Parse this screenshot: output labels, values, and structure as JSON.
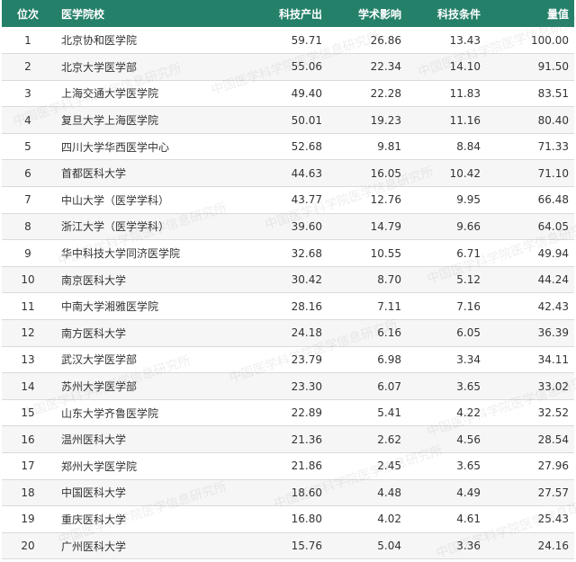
{
  "headers": {
    "rank": "位次",
    "school": "医学院校",
    "output": "科技产出",
    "influence": "学术影响",
    "conditions": "科技条件",
    "score": "量值"
  },
  "rows": [
    {
      "rank": "1",
      "school": "北京协和医学院",
      "output": "59.71",
      "influence": "26.86",
      "conditions": "13.43",
      "score": "100.00"
    },
    {
      "rank": "2",
      "school": "北京大学医学部",
      "output": "55.06",
      "influence": "22.34",
      "conditions": "14.10",
      "score": "91.50"
    },
    {
      "rank": "3",
      "school": "上海交通大学医学院",
      "output": "49.40",
      "influence": "22.28",
      "conditions": "11.83",
      "score": "83.51"
    },
    {
      "rank": "4",
      "school": "复旦大学上海医学院",
      "output": "50.01",
      "influence": "19.23",
      "conditions": "11.16",
      "score": "80.40"
    },
    {
      "rank": "5",
      "school": "四川大学华西医学中心",
      "output": "52.68",
      "influence": "9.81",
      "conditions": "8.84",
      "score": "71.33"
    },
    {
      "rank": "6",
      "school": "首都医科大学",
      "output": "44.63",
      "influence": "16.05",
      "conditions": "10.42",
      "score": "71.10"
    },
    {
      "rank": "7",
      "school": "中山大学（医学学科）",
      "output": "43.77",
      "influence": "12.76",
      "conditions": "9.95",
      "score": "66.48"
    },
    {
      "rank": "8",
      "school": "浙江大学（医学学科）",
      "output": "39.60",
      "influence": "14.79",
      "conditions": "9.66",
      "score": "64.05"
    },
    {
      "rank": "9",
      "school": "华中科技大学同济医学院",
      "output": "32.68",
      "influence": "10.55",
      "conditions": "6.71",
      "score": "49.94"
    },
    {
      "rank": "10",
      "school": "南京医科大学",
      "output": "30.42",
      "influence": "8.70",
      "conditions": "5.12",
      "score": "44.24"
    },
    {
      "rank": "11",
      "school": "中南大学湘雅医学院",
      "output": "28.16",
      "influence": "7.11",
      "conditions": "7.16",
      "score": "42.43"
    },
    {
      "rank": "12",
      "school": "南方医科大学",
      "output": "24.18",
      "influence": "6.16",
      "conditions": "6.05",
      "score": "36.39"
    },
    {
      "rank": "13",
      "school": "武汉大学医学部",
      "output": "23.79",
      "influence": "6.98",
      "conditions": "3.34",
      "score": "34.11"
    },
    {
      "rank": "14",
      "school": "苏州大学医学部",
      "output": "23.30",
      "influence": "6.07",
      "conditions": "3.65",
      "score": "33.02"
    },
    {
      "rank": "15",
      "school": "山东大学齐鲁医学院",
      "output": "22.89",
      "influence": "5.41",
      "conditions": "4.22",
      "score": "32.52"
    },
    {
      "rank": "16",
      "school": "温州医科大学",
      "output": "21.36",
      "influence": "2.62",
      "conditions": "4.56",
      "score": "28.54"
    },
    {
      "rank": "17",
      "school": "郑州大学医学院",
      "output": "21.86",
      "influence": "2.45",
      "conditions": "3.65",
      "score": "27.96"
    },
    {
      "rank": "18",
      "school": "中国医科大学",
      "output": "18.60",
      "influence": "4.48",
      "conditions": "4.49",
      "score": "27.57"
    },
    {
      "rank": "19",
      "school": "重庆医科大学",
      "output": "16.80",
      "influence": "4.02",
      "conditions": "4.61",
      "score": "25.43"
    },
    {
      "rank": "20",
      "school": "广州医科大学",
      "output": "15.76",
      "influence": "5.04",
      "conditions": "3.36",
      "score": "24.16"
    }
  ],
  "watermark": "中国医学科学院医学信息研究所",
  "colors": {
    "header_bg": "#25806a",
    "header_text": "#ffffff",
    "row_alt": "#f6f6f6",
    "text": "#333333"
  }
}
